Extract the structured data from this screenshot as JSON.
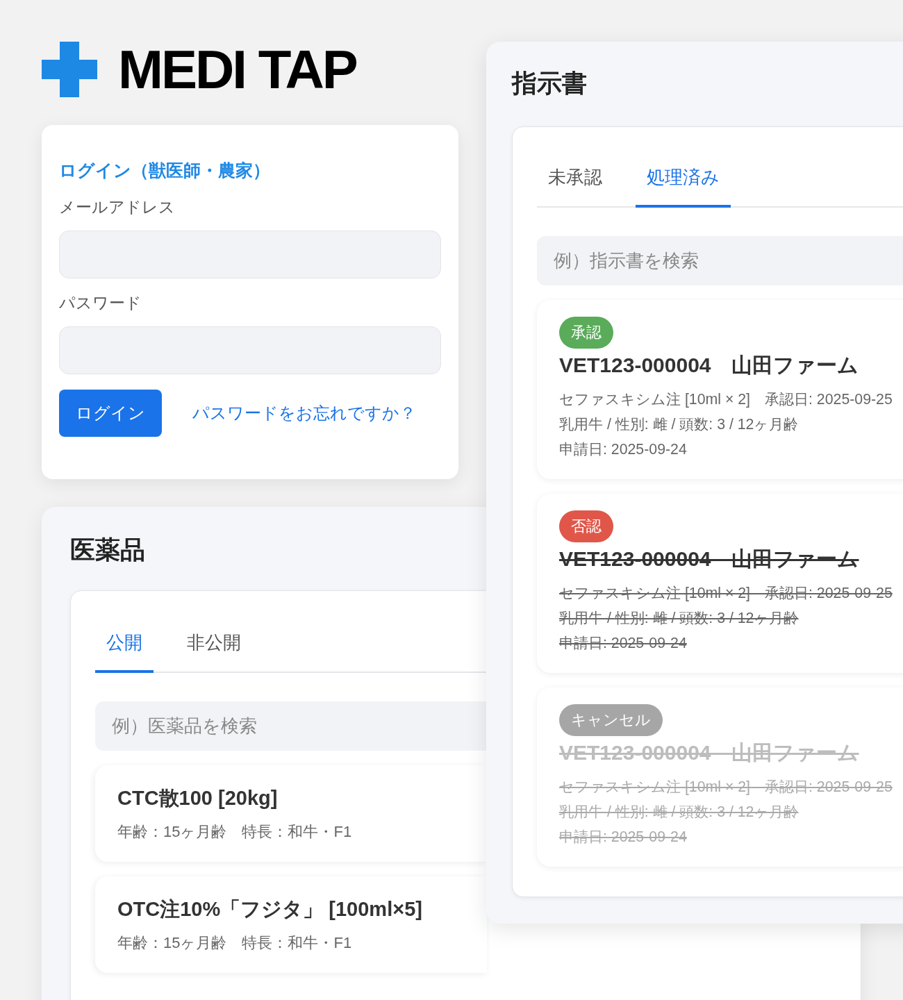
{
  "logo": {
    "text": "MEDI TAP"
  },
  "login": {
    "title": "ログイン（獣医師・農家）",
    "fields": [
      {
        "label": "メールアドレス"
      },
      {
        "label": "パスワード"
      }
    ],
    "button": "ログイン",
    "forgot_link": "パスワードをお忘れですか？"
  },
  "medicines": {
    "title": "医薬品",
    "tabs": [
      {
        "label": "公開",
        "selected": true
      },
      {
        "label": "非公開",
        "selected": false
      }
    ],
    "search": {
      "placeholder": "例）医薬品を検索"
    },
    "items": [
      {
        "name": "CTC散100 [20kg]",
        "details": "年齢：15ヶ月齢　特長：和牛・F1"
      },
      {
        "name": "OTC注10%「フジタ」 [100ml×5]",
        "details": "年齢：15ヶ月齢　特長：和牛・F1"
      }
    ]
  },
  "instructions": {
    "title": "指示書",
    "tabs": [
      {
        "label": "未承認",
        "selected": false
      },
      {
        "label": "処理済み",
        "selected": true
      }
    ],
    "search": {
      "placeholder": "例）指示書を検索"
    },
    "items": [
      {
        "kind": "approved",
        "status": {
          "label": "承認",
          "color": "#5aab5a"
        },
        "title": "VET123-000004　山田ファーム",
        "lines": [
          "セファスキシム注 [10ml × 2]　承認日: 2025-09-25",
          "乳用牛 / 性別: 雌 / 頭数: 3 / 12ヶ月齢",
          "申請日: 2025-09-24"
        ]
      },
      {
        "kind": "rejected",
        "status": {
          "label": "否認",
          "color": "#e0574a"
        },
        "title": "VET123-000004　山田ファーム",
        "lines": [
          "セファスキシム注 [10ml × 2]　承認日: 2025-09-25",
          "乳用牛 / 性別: 雌 / 頭数: 3 / 12ヶ月齢",
          "申請日: 2025-09-24"
        ]
      },
      {
        "kind": "cancelled",
        "status": {
          "label": "キャンセル",
          "color": "#a6a6a6"
        },
        "title": "VET123-000004　山田ファーム",
        "lines": [
          "セファスキシム注 [10ml × 2]　承認日: 2025-09-25",
          "乳用牛 / 性別: 雌 / 頭数: 3 / 12ヶ月齢",
          "申請日: 2025-09-24"
        ]
      }
    ]
  }
}
